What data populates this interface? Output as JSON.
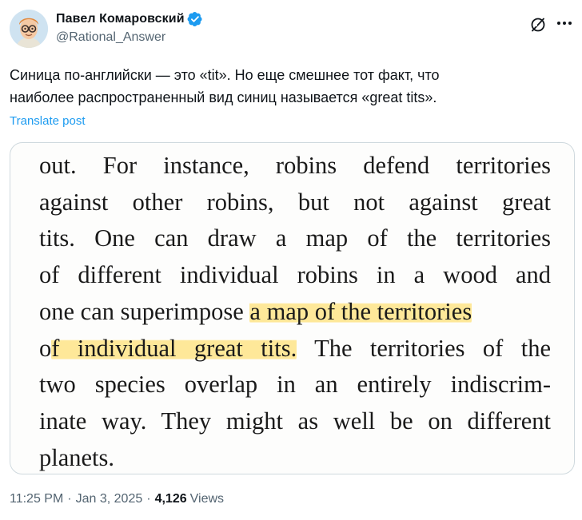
{
  "author": {
    "display_name": "Павел Комаровский",
    "handle": "@Rational_Answer",
    "verified": true,
    "avatar_icon": "cartoon-avatar-icon"
  },
  "tweet": {
    "text_line1": "Синица по-английски — это «tit». Но еще смешнее тот факт, что",
    "text_line2": "наиболее распространенный вид синиц называется «great tits».",
    "translate_label": "Translate post"
  },
  "book_excerpt": {
    "line1": "out. For instance, robins defend territories",
    "line2": "against other robins, but not against great",
    "line3": "tits. One can draw a map of the territories",
    "line4": "of different individual robins in a wood and",
    "line5_pre": "one can superimpose ",
    "line5_hl": "a map of the territories",
    "line6_pre": "o",
    "line6_hl": "f individual great tits.",
    "line6_post": " The territories of the",
    "line7": "two species overlap in an entirely indiscrim-",
    "line8": "inate way. They might as well be on different",
    "line9": "planets.",
    "highlight_color": "#ffe178"
  },
  "meta": {
    "time": "11:25 PM",
    "date": "Jan 3, 2025",
    "views_count": "4,126",
    "views_label": "Views"
  },
  "colors": {
    "accent": "#1d9bf0",
    "muted": "#536471",
    "text": "#0f1419"
  }
}
